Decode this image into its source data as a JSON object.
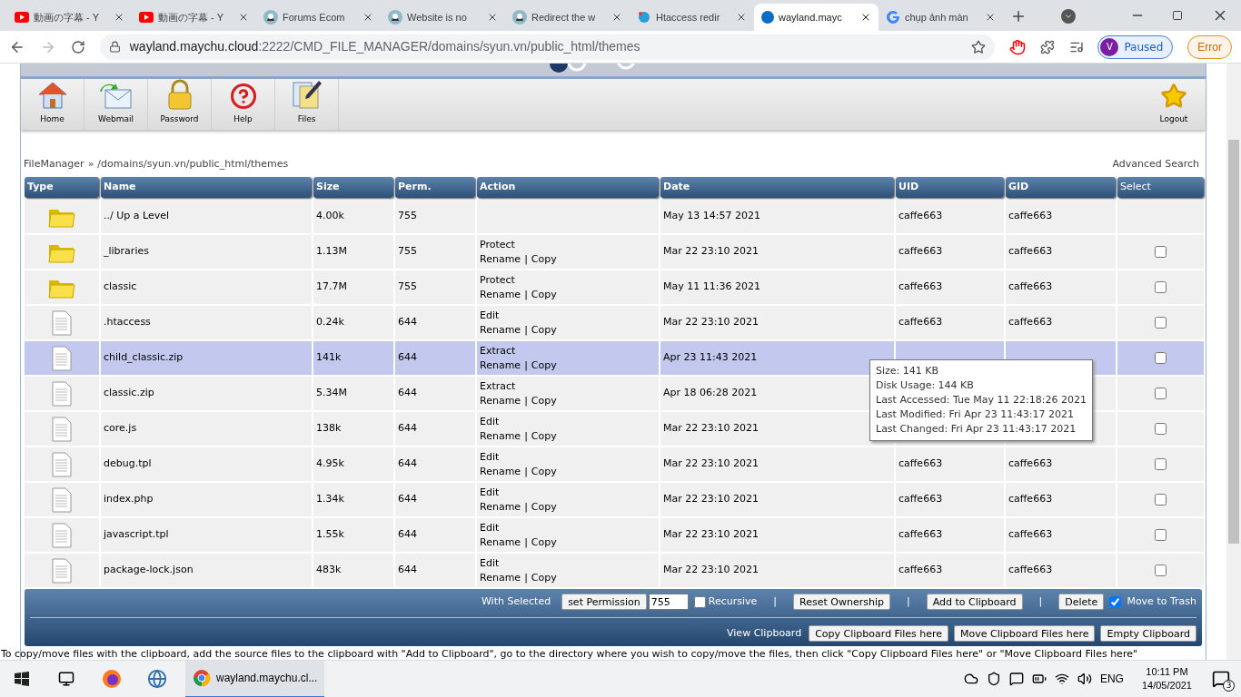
{
  "browser": {
    "tabs": [
      {
        "title": "動画の字幕 - Y",
        "kind": "video",
        "selected": false
      },
      {
        "title": "動画の字幕 - Y",
        "kind": "video",
        "selected": false
      },
      {
        "title": "Forums Ecom",
        "kind": "forum",
        "selected": false
      },
      {
        "title": "Website is no",
        "kind": "forum",
        "selected": false
      },
      {
        "title": "Redirect the w",
        "kind": "forum",
        "selected": false
      },
      {
        "title": "Htaccess redir",
        "kind": "globe",
        "selected": false
      },
      {
        "title": "wayland.mayc",
        "kind": "site",
        "selected": true
      },
      {
        "title": "chụp ảnh màn",
        "kind": "search",
        "selected": false
      }
    ],
    "url_host": "wayland.maychu.cloud",
    "url_rest": ":2222/CMD_FILE_MANAGER/domains/syun.vn/public_html/themes",
    "profile": {
      "initial": "V",
      "label": "Paused"
    },
    "error_button": "Error"
  },
  "toolbar": {
    "items": [
      {
        "label": "Home",
        "kind": "home"
      },
      {
        "label": "Webmail",
        "kind": "mail"
      },
      {
        "label": "Password",
        "kind": "lock"
      },
      {
        "label": "Help",
        "kind": "help"
      },
      {
        "label": "Files",
        "kind": "files"
      }
    ],
    "logout": "Logout"
  },
  "breadcrumb": {
    "root": "FileManager",
    "sep": "»",
    "path": "/domains/syun.vn/public_html/themes"
  },
  "advanced_search": "Advanced Search",
  "table": {
    "columns": [
      "Type",
      "Name",
      "Size",
      "Perm.",
      "Action",
      "Date",
      "UID",
      "GID",
      "Select"
    ],
    "rows": [
      {
        "kind": "folder",
        "name": "../ Up a Level",
        "size": "4.00k",
        "perm": "755",
        "date": "May 13 14:57 2021",
        "uid": "caffe663",
        "gid": "caffe663",
        "selected": false
      },
      {
        "kind": "folder",
        "name": "_libraries",
        "size": "1.13M",
        "perm": "755",
        "action": "Protect",
        "links": [
          "Rename",
          "|",
          "Copy"
        ],
        "date": "Mar 22 23:10 2021",
        "uid": "caffe663",
        "gid": "caffe663",
        "selected": false,
        "checked": false
      },
      {
        "kind": "folder",
        "name": "classic",
        "size": "17.7M",
        "perm": "755",
        "action": "Protect",
        "links": [
          "Rename",
          "|",
          "Copy"
        ],
        "date": "May 11 11:36 2021",
        "uid": "caffe663",
        "gid": "caffe663",
        "selected": false,
        "checked": false
      },
      {
        "kind": "file",
        "name": ".htaccess",
        "size": "0.24k",
        "perm": "644",
        "action": "Edit",
        "links": [
          "Rename",
          "|",
          "Copy"
        ],
        "date": "Mar 22 23:10 2021",
        "uid": "caffe663",
        "gid": "caffe663",
        "selected": false,
        "checked": false
      },
      {
        "kind": "file",
        "name": "child_classic.zip",
        "size": "141k",
        "perm": "644",
        "action": "Extract",
        "links": [
          "Rename",
          "|",
          "Copy"
        ],
        "date": "Apr 23 11:43 2021",
        "selected": true,
        "checked": false
      },
      {
        "kind": "file",
        "name": "classic.zip",
        "size": "5.34M",
        "perm": "644",
        "action": "Extract",
        "links": [
          "Rename",
          "|",
          "Copy"
        ],
        "date": "Apr 18 06:28 2021",
        "selected": false,
        "checked": false
      },
      {
        "kind": "file",
        "name": "core.js",
        "size": "138k",
        "perm": "644",
        "action": "Edit",
        "links": [
          "Rename",
          "|",
          "Copy"
        ],
        "date": "Mar 22 23:10 2021",
        "selected": false,
        "checked": false
      },
      {
        "kind": "file",
        "name": "debug.tpl",
        "size": "4.95k",
        "perm": "644",
        "action": "Edit",
        "links": [
          "Rename",
          "|",
          "Copy"
        ],
        "date": "Mar 22 23:10 2021",
        "uid": "caffe663",
        "gid": "caffe663",
        "selected": false,
        "checked": false
      },
      {
        "kind": "file",
        "name": "index.php",
        "size": "1.34k",
        "perm": "644",
        "action": "Edit",
        "links": [
          "Rename",
          "|",
          "Copy"
        ],
        "date": "Mar 22 23:10 2021",
        "uid": "caffe663",
        "gid": "caffe663",
        "selected": false,
        "checked": false
      },
      {
        "kind": "file",
        "name": "javascript.tpl",
        "size": "1.55k",
        "perm": "644",
        "action": "Edit",
        "links": [
          "Rename",
          "|",
          "Copy"
        ],
        "date": "Mar 22 23:10 2021",
        "uid": "caffe663",
        "gid": "caffe663",
        "selected": false,
        "checked": false
      },
      {
        "kind": "file",
        "name": "package-lock.json",
        "size": "483k",
        "perm": "644",
        "action": "Edit",
        "links": [
          "Rename",
          "|",
          "Copy"
        ],
        "date": "Mar 22 23:10 2021",
        "uid": "caffe663",
        "gid": "caffe663",
        "selected": false,
        "checked": false
      }
    ]
  },
  "tooltip": {
    "lines": [
      "Size: 141 KB",
      "Disk Usage: 144 KB",
      "Last Accessed: Tue May 11 22:18:26 2021",
      "Last Modified: Fri Apr 23 11:43:17 2021",
      "Last Changed: Fri Apr 23 11:43:17 2021"
    ]
  },
  "actions": {
    "with_selected": "With Selected",
    "set_permission": "set Permission",
    "permission_value": "755",
    "recursive": {
      "label": "Recursive",
      "checked": false
    },
    "sep": "|",
    "reset_ownership": "Reset Ownership",
    "add_to_clipboard": "Add to Clipboard",
    "delete": "Delete",
    "move_to_trash": {
      "label": "Move to Trash",
      "checked": true
    },
    "view_clipboard": "View Clipboard",
    "copy_here": "Copy Clipboard Files here",
    "move_here": "Move Clipboard Files here",
    "empty": "Empty Clipboard"
  },
  "note": "To copy/move files with the clipboard, add the source files to the clipboard with \"Add to Clipboard\", go to the directory where you wish to copy/move the files, then click \"Copy Clipboard Files here\" or \"Move Clipboard Files here\"",
  "taskbar": {
    "chrome_label": "wayland.maychu.cl...",
    "language": "ENG",
    "time": "10:11 PM",
    "date": "14/05/2021",
    "notifications": "3"
  }
}
